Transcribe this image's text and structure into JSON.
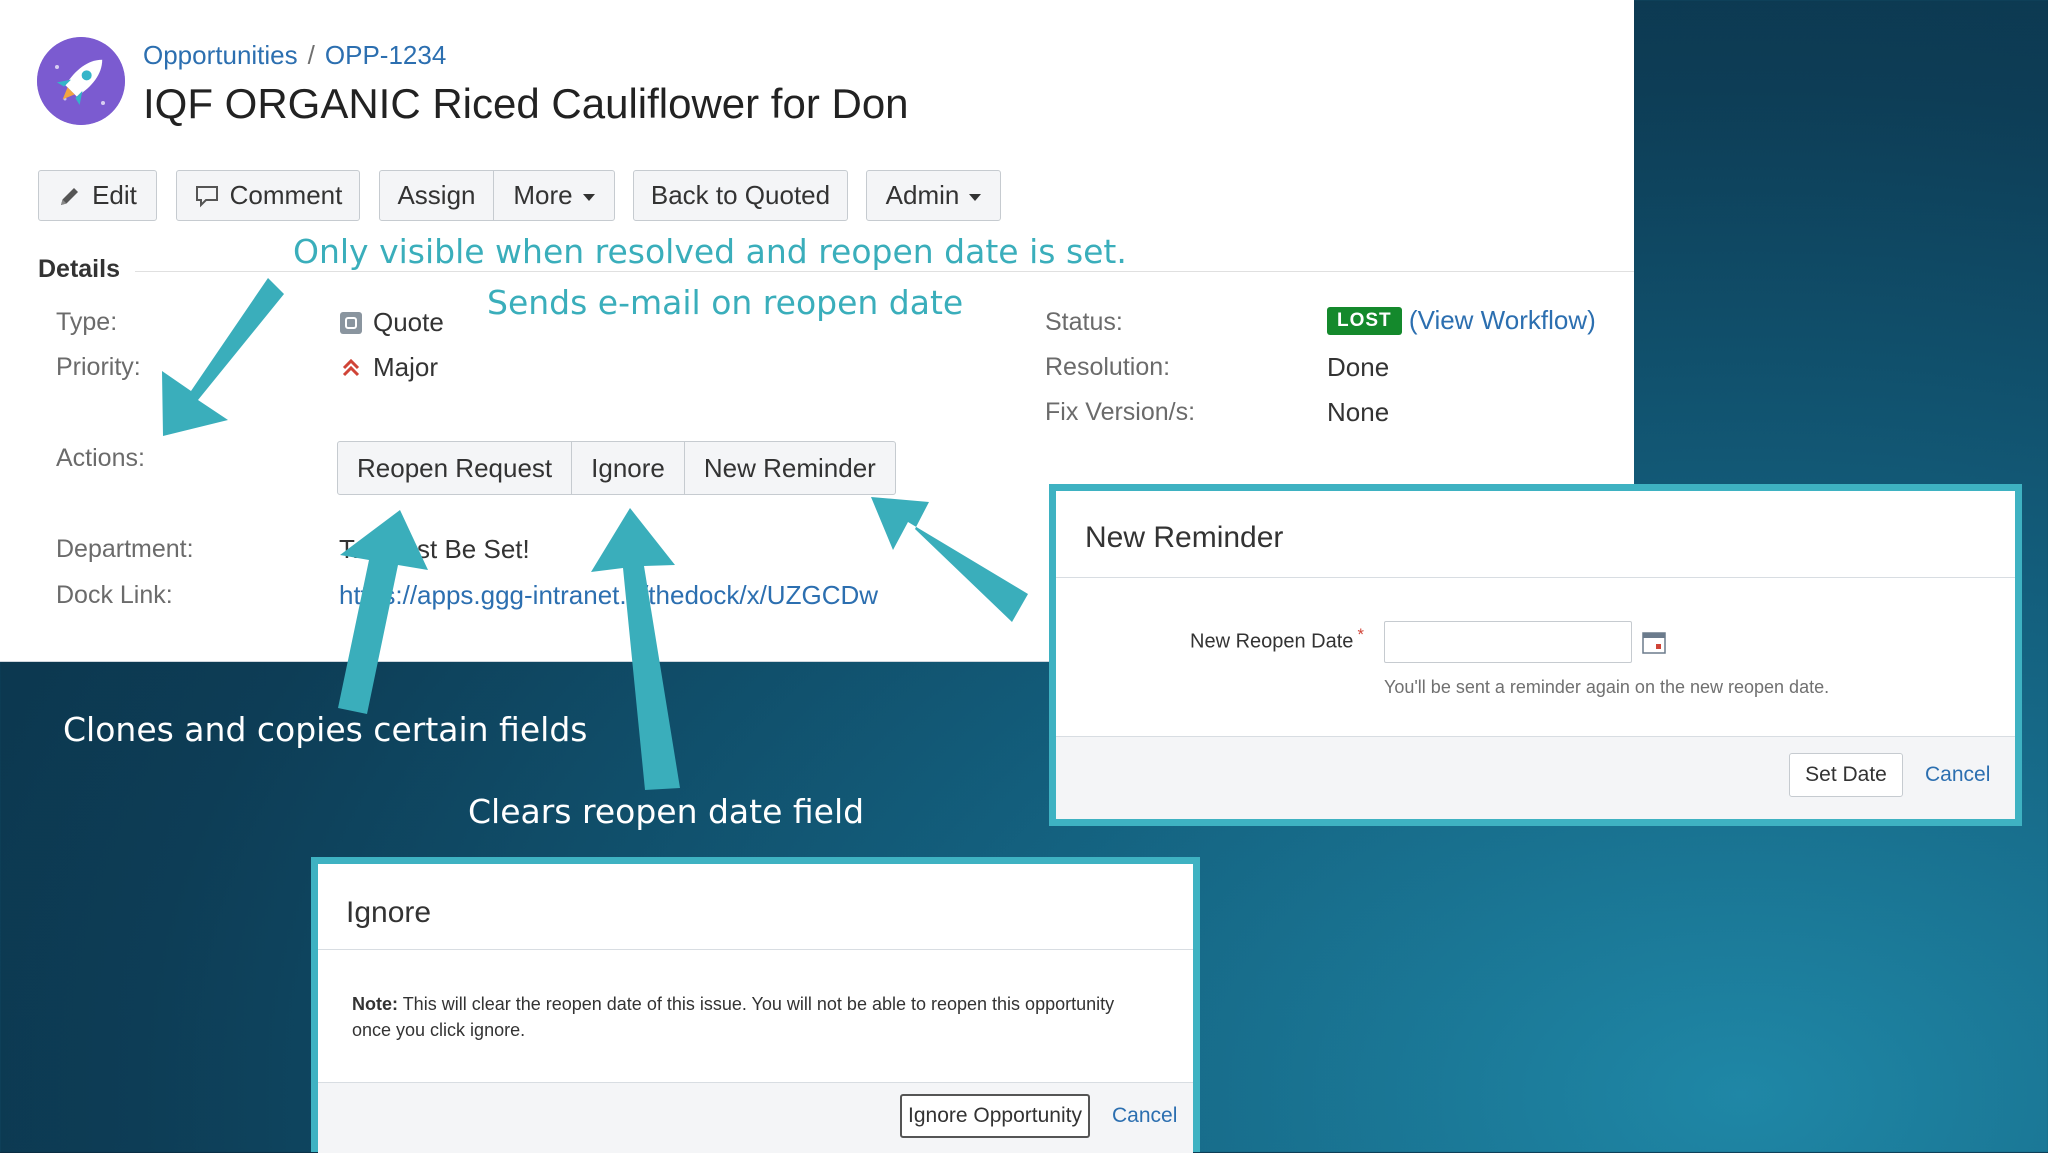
{
  "header": {
    "breadcrumb": {
      "project": "Opportunities",
      "separator": "/",
      "issue_key": "OPP-1234"
    },
    "title": "IQF ORGANIC Riced Cauliflower for Don"
  },
  "toolbar": {
    "edit": "Edit",
    "comment": "Comment",
    "assign": "Assign",
    "more": "More",
    "back_to_quoted": "Back to Quoted",
    "admin": "Admin"
  },
  "details": {
    "heading": "Details",
    "type_label": "Type:",
    "type_value": "Quote",
    "priority_label": "Priority:",
    "priority_value": "Major",
    "actions_label": "Actions:",
    "department_label": "Department:",
    "department_value": "T... Must Be Set!",
    "dock_link_label": "Dock Link:",
    "dock_link_value": "https://apps.ggg-intranet.../thedock/x/UZGCDw",
    "status_label": "Status:",
    "status_value": "LOST",
    "view_workflow": "View Workflow",
    "resolution_label": "Resolution:",
    "resolution_value": "Done",
    "fix_version_label": "Fix Version/s:",
    "fix_version_value": "None"
  },
  "actions": {
    "reopen_request": "Reopen Request",
    "ignore": "Ignore",
    "new_reminder": "New Reminder"
  },
  "callouts": {
    "visible_note": "Only visible when resolved and reopen date is set.",
    "email_note": "Sends e-mail on reopen date",
    "clones_note": "Clones and copies certain fields",
    "clears_note": "Clears reopen date field"
  },
  "reminder_dialog": {
    "title": "New Reminder",
    "field_label": "New Reopen Date",
    "required_mark": "*",
    "field_value": "",
    "help_text": "You'll be sent a reminder again on the new reopen date.",
    "set_date": "Set Date",
    "cancel": "Cancel"
  },
  "ignore_dialog": {
    "title": "Ignore",
    "note_label": "Note:",
    "note_text": "This will clear the reopen date of this issue. You will not be able to reopen this opportunity once you click ignore.",
    "ignore_button": "Ignore Opportunity",
    "cancel": "Cancel"
  },
  "colors": {
    "link": "#2c6fb0",
    "lost_lozenge": "#14892c",
    "callout_teal": "#3aaebb",
    "dialog_border": "#3eb2c2",
    "avatar": "#7b5bd0"
  },
  "icons": [
    "rocket-icon",
    "pencil-icon",
    "comment-icon",
    "quote-type-icon",
    "major-priority-icon",
    "calendar-icon"
  ]
}
